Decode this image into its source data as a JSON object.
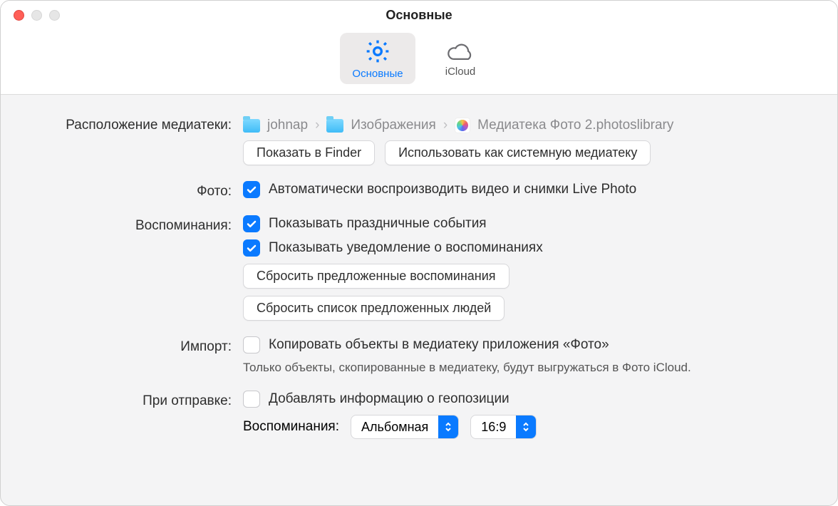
{
  "window": {
    "title": "Основные"
  },
  "tabs": {
    "general": "Основные",
    "icloud": "iCloud"
  },
  "loc": {
    "label": "Расположение медиатеки:",
    "crumb1": "johnap",
    "crumb2": "Изображения",
    "crumb3": "Медиатека Фото 2.photoslibrary",
    "show_btn": "Показать в Finder",
    "system_btn": "Использовать как системную медиатеку"
  },
  "photo": {
    "label": "Фото:",
    "autoplay": "Автоматически воспроизводить видео и снимки Live Photo"
  },
  "mem": {
    "label": "Воспоминания:",
    "holidays": "Показывать праздничные события",
    "notify": "Показывать уведомление о воспоминаниях",
    "reset_mem": "Сбросить предложенные воспоминания",
    "reset_people": "Сбросить список предложенных людей"
  },
  "import": {
    "label": "Импорт:",
    "copy": "Копировать объекты в медиатеку приложения «Фото»",
    "note": "Только объекты, скопированные в медиатеку, будут выгружаться в Фото iCloud."
  },
  "share": {
    "label": "При отправке:",
    "geo": "Добавлять информацию о геопозиции",
    "mem_label": "Воспоминания:",
    "orient": "Альбомная",
    "ratio": "16:9"
  }
}
